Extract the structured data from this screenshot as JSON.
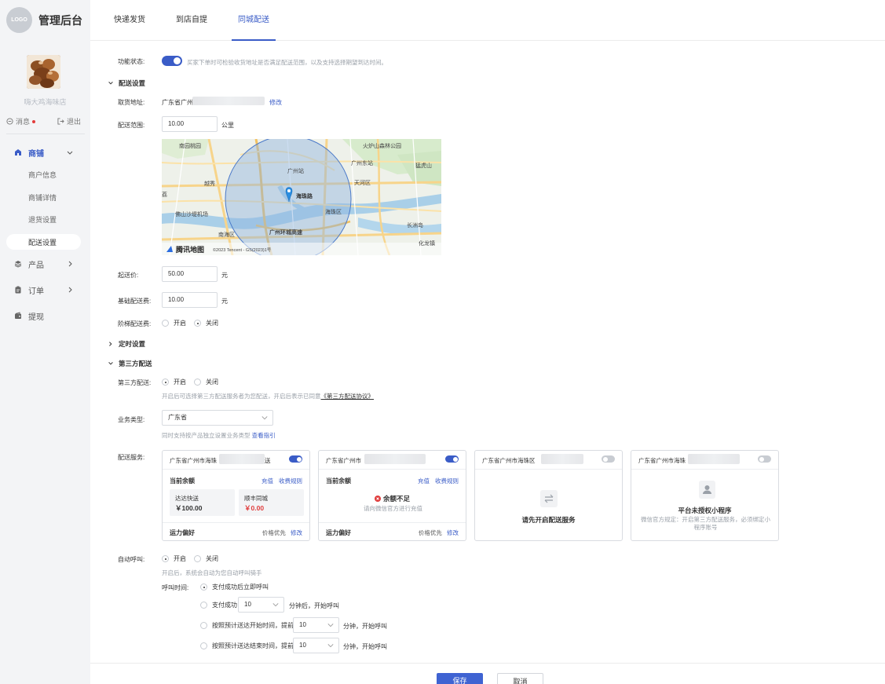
{
  "sidebar": {
    "logo_text": "LOGO",
    "app_title": "管理后台",
    "shop_name": "嗨大鸡海味店",
    "messages_label": "消息",
    "logout_label": "退出",
    "menu": {
      "shop": "商铺",
      "shop_sub": [
        "商户信息",
        "商铺详情",
        "退货设置",
        "配送设置"
      ],
      "products": "产品",
      "orders": "订单",
      "withdraw": "提现"
    }
  },
  "tabs": [
    "快递发货",
    "到店自提",
    "同城配送"
  ],
  "feature_status": {
    "label": "功能状态:",
    "hint": "买家下单时可检验收货地址是否满足配送范围，以及支持选择期望到达时间。"
  },
  "delivery_settings": {
    "title": "配送设置",
    "pickup_label": "取货地址:",
    "pickup_value": "广东省广州",
    "pickup_edit": "修改",
    "range_label": "配送范围:",
    "range_value": "10.00",
    "range_unit": "公里",
    "map": {
      "labels": [
        "南园桃园",
        "火炉山森林公园",
        "广州东站",
        "猛虎山",
        "广州站",
        "天河区",
        "荔",
        "越秀",
        "佛山沙堤机场",
        "海珠区",
        "南海区",
        "广州环城高速",
        "长洲岛",
        "化龙镇",
        "海珠路"
      ],
      "brand": "腾讯地图",
      "copyright": "©2023 Tencent - GS(2023)1号"
    },
    "min_price_label": "起送价:",
    "min_price_value": "50.00",
    "base_fee_label": "基础配送费:",
    "base_fee_value": "10.00",
    "currency_unit": "元",
    "tier_label": "阶梯配送费:",
    "on": "开启",
    "off": "关闭"
  },
  "timed_settings": {
    "title": "定时设置"
  },
  "third_party": {
    "title": "第三方配送",
    "label": "第三方配送:",
    "on": "开启",
    "off": "关闭",
    "hint_prefix": "开启后可选择第三方配送服务者为您配送，开启后表示已同意",
    "hint_link": "《第三方配送协议》",
    "biz_type_label": "业务类型:",
    "biz_type_value": "广东省",
    "biz_hint": "同时支持按产品独立设置业务类型",
    "biz_hint_link": "查看指引",
    "service_label": "配送服务:",
    "cards": [
      {
        "addr": "广东省广州市海珠",
        "addr_tail": "送",
        "enabled": true,
        "balance_title": "当前余额",
        "recharge": "充值",
        "fee_rule": "收费规则",
        "boxes": [
          {
            "label": "达达快送",
            "value": "￥100.00"
          },
          {
            "label": "顺丰同城",
            "value": "￥0.00"
          }
        ],
        "pref_title": "运力偏好",
        "pref_value": "价格优先",
        "pref_edit": "修改"
      },
      {
        "addr": "广东省广州市",
        "enabled": true,
        "balance_title": "当前余额",
        "recharge": "充值",
        "fee_rule": "收费规则",
        "warn_title": "余额不足",
        "warn_sub": "请向微信官方进行充值",
        "pref_title": "运力偏好",
        "pref_value": "价格优先",
        "pref_edit": "修改"
      },
      {
        "addr": "广东省广州市海珠区",
        "enabled": false,
        "center_title": "请先开启配送服务"
      },
      {
        "addr": "广东省广州市海珠",
        "enabled": false,
        "center_title": "平台未授权小程序",
        "center_sub": "微信官方规定：开启第三方配送服务，必须绑定小程序账号"
      }
    ]
  },
  "auto_call": {
    "label": "自动呼叫:",
    "on": "开启",
    "off": "关闭",
    "hint": "开启后，系统会自动为您自动呼叫骑手",
    "time_label": "呼叫时间:",
    "opt1": "支付成功后立即呼叫",
    "opt2_prefix": "支付成功",
    "opt2_value": "10",
    "opt2_suffix": "分钟后，开始呼叫",
    "opt3_prefix": "按照预计送达开始时间，提前",
    "opt3_value": "10",
    "opt3_suffix": "分钟，开始呼叫",
    "opt4_prefix": "按照预计送达结束时间，提前",
    "opt4_value": "10",
    "opt4_suffix": "分钟，开始呼叫"
  },
  "footer": {
    "save": "保存",
    "cancel": "取消"
  },
  "colors": {
    "accent": "#3a5cc7",
    "danger": "#e03c3c"
  }
}
